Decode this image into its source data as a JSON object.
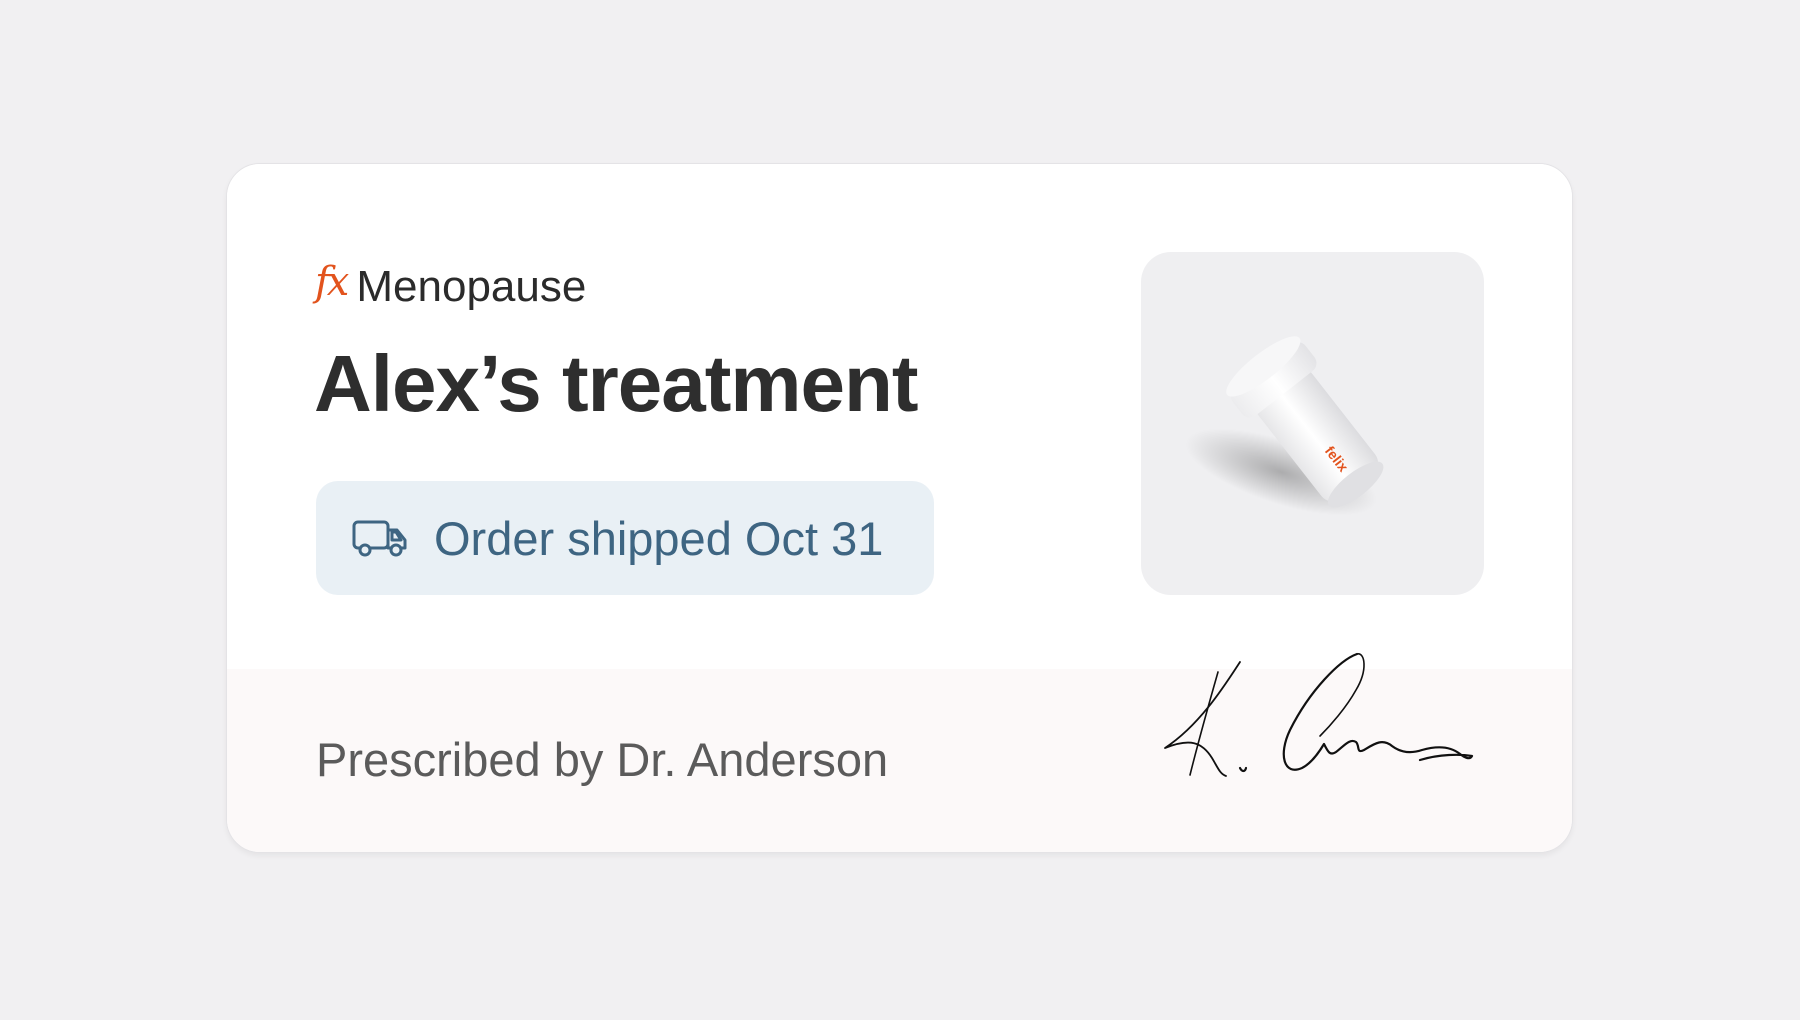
{
  "card": {
    "brand": {
      "logo_text": "fx",
      "name": "Menopause"
    },
    "title": "Alex’s treatment",
    "status": {
      "icon": "truck-icon",
      "text": "Order shipped Oct 31"
    },
    "product_image": {
      "subject": "white medication bottle",
      "label_text": "felix"
    },
    "footer": {
      "prescriber_text": "Prescribed by Dr. Anderson",
      "signature": "handwritten doctor signature"
    }
  },
  "colors": {
    "page_background": "#f1f0f2",
    "card_background": "#ffffff",
    "footer_background": "#fcf9f9",
    "brand_accent": "#e2531d",
    "title_text": "#2e2e2e",
    "status_pill_background": "#e9f0f5",
    "status_text": "#3e6582",
    "prescriber_text": "#5b5b5b"
  }
}
